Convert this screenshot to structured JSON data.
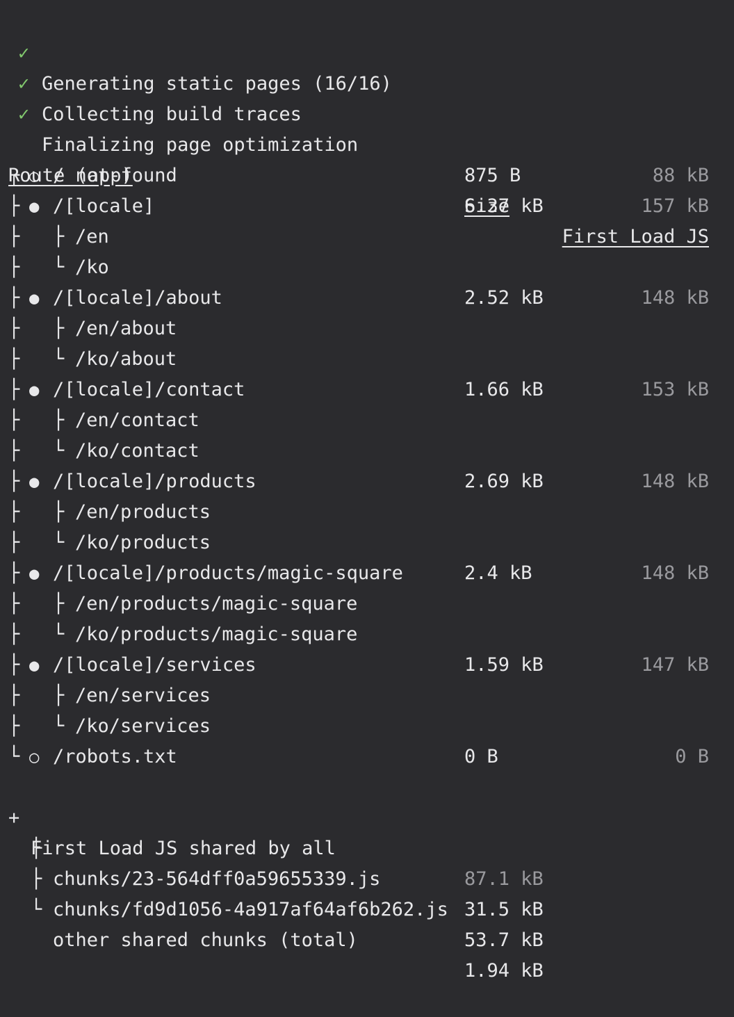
{
  "steps": [
    {
      "check": "✓",
      "text": "Generating static pages (16/16)"
    },
    {
      "check": "✓",
      "text": "Collecting build traces"
    },
    {
      "check": "✓",
      "text": "Finalizing page optimization"
    }
  ],
  "table_header": {
    "route": "Route (app)",
    "size": "Size",
    "first_load": "First Load JS"
  },
  "routes": [
    {
      "tree": "┌",
      "marker": "○",
      "route": "/_not-found",
      "size": "875 B",
      "first_load": "88 kB"
    },
    {
      "tree": "├",
      "marker": "●",
      "route": "/[locale]",
      "size": "6.37 kB",
      "first_load": "157 kB"
    },
    {
      "tree": "├",
      "sub_branch": "├",
      "sub_route": "/en"
    },
    {
      "tree": "├",
      "sub_branch": "└",
      "sub_route": "/ko"
    },
    {
      "tree": "├",
      "marker": "●",
      "route": "/[locale]/about",
      "size": "2.52 kB",
      "first_load": "148 kB"
    },
    {
      "tree": "├",
      "sub_branch": "├",
      "sub_route": "/en/about"
    },
    {
      "tree": "├",
      "sub_branch": "└",
      "sub_route": "/ko/about"
    },
    {
      "tree": "├",
      "marker": "●",
      "route": "/[locale]/contact",
      "size": "1.66 kB",
      "first_load": "153 kB"
    },
    {
      "tree": "├",
      "sub_branch": "├",
      "sub_route": "/en/contact"
    },
    {
      "tree": "├",
      "sub_branch": "└",
      "sub_route": "/ko/contact"
    },
    {
      "tree": "├",
      "marker": "●",
      "route": "/[locale]/products",
      "size": "2.69 kB",
      "first_load": "148 kB"
    },
    {
      "tree": "├",
      "sub_branch": "├",
      "sub_route": "/en/products"
    },
    {
      "tree": "├",
      "sub_branch": "└",
      "sub_route": "/ko/products"
    },
    {
      "tree": "├",
      "marker": "●",
      "route": "/[locale]/products/magic-square",
      "size": "2.4 kB",
      "first_load": "148 kB"
    },
    {
      "tree": "├",
      "sub_branch": "├",
      "sub_route": "/en/products/magic-square"
    },
    {
      "tree": "├",
      "sub_branch": "└",
      "sub_route": "/ko/products/magic-square"
    },
    {
      "tree": "├",
      "marker": "●",
      "route": "/[locale]/services",
      "size": "1.59 kB",
      "first_load": "147 kB"
    },
    {
      "tree": "├",
      "sub_branch": "├",
      "sub_route": "/en/services"
    },
    {
      "tree": "├",
      "sub_branch": "└",
      "sub_route": "/ko/services"
    },
    {
      "tree": "└",
      "marker": "○",
      "route": "/robots.txt",
      "size": "0 B",
      "first_load": "0 B"
    }
  ],
  "shared": {
    "plus": "+",
    "label": "First Load JS shared by all",
    "size": "87.1 kB",
    "chunks": [
      {
        "branch": "├",
        "name": "chunks/23-564dff0a59655339.js",
        "size": "31.5 kB"
      },
      {
        "branch": "├",
        "name": "chunks/fd9d1056-4a917af64af6b262.js",
        "size": "53.7 kB"
      },
      {
        "branch": "└",
        "name": "other shared chunks (total)",
        "size": "1.94 kB"
      }
    ]
  }
}
